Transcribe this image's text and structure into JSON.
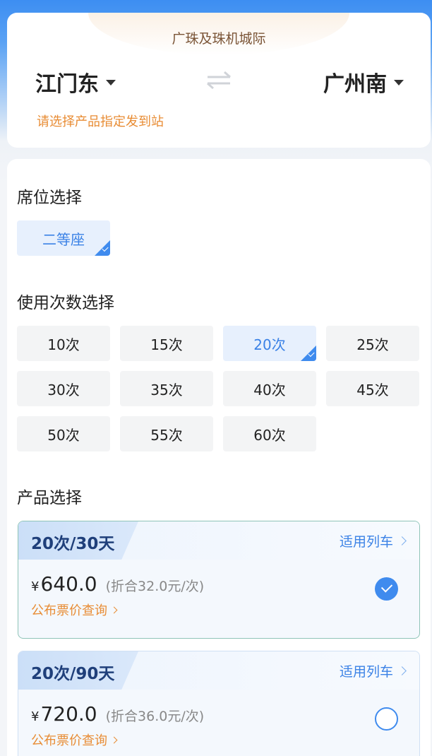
{
  "route": {
    "banner_title": "广珠及珠机城际",
    "from_station": "江门东",
    "to_station": "广州南",
    "hint": "请选择产品指定发到站"
  },
  "seat_section": {
    "title": "席位选择",
    "options": [
      {
        "label": "二等座",
        "selected": true
      }
    ]
  },
  "count_section": {
    "title": "使用次数选择",
    "options": [
      {
        "label": "10次",
        "selected": false
      },
      {
        "label": "15次",
        "selected": false
      },
      {
        "label": "20次",
        "selected": true
      },
      {
        "label": "25次",
        "selected": false
      },
      {
        "label": "30次",
        "selected": false
      },
      {
        "label": "35次",
        "selected": false
      },
      {
        "label": "40次",
        "selected": false
      },
      {
        "label": "45次",
        "selected": false
      },
      {
        "label": "50次",
        "selected": false
      },
      {
        "label": "55次",
        "selected": false
      },
      {
        "label": "60次",
        "selected": false
      }
    ]
  },
  "product_section": {
    "title": "产品选择",
    "products": [
      {
        "tag": "20次/30天",
        "train_link": "适用列车",
        "currency": "¥",
        "price": "640.0",
        "per_trip": "(折合32.0元/次)",
        "fare_link": "公布票价查询",
        "selected": true
      },
      {
        "tag": "20次/90天",
        "train_link": "适用列车",
        "currency": "¥",
        "price": "720.0",
        "per_trip": "(折合36.0元/次)",
        "fare_link": "公布票价查询",
        "selected": false
      }
    ]
  },
  "colors": {
    "accent": "#3f8bee",
    "orange": "#e88c34",
    "header_blue": "#3d8ef2"
  }
}
